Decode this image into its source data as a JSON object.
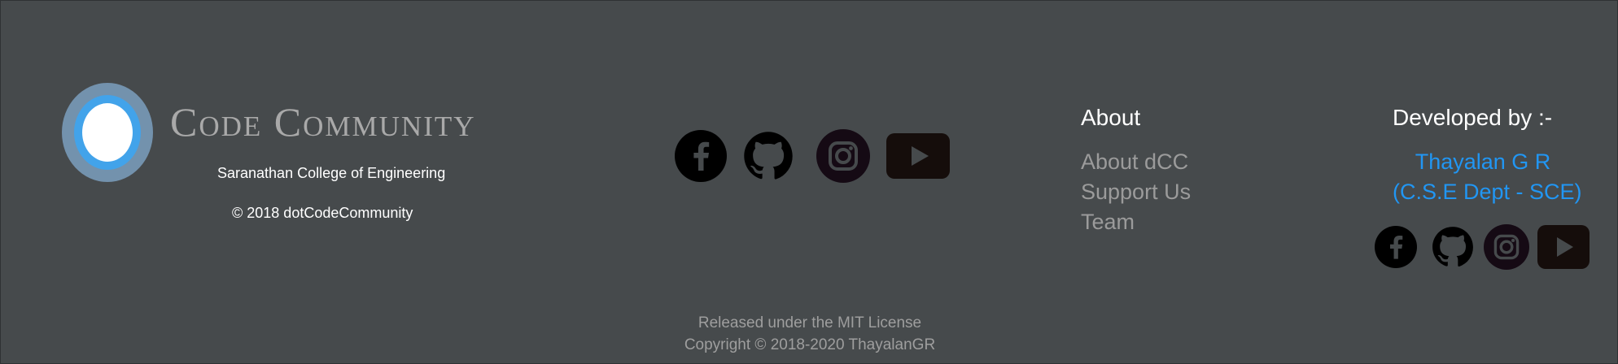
{
  "brand": {
    "name": "Code Community",
    "college": "Saranathan College of Engineering",
    "copyright": "© 2018 dotCodeCommunity"
  },
  "social_main": [
    {
      "icon": "facebook-icon"
    },
    {
      "icon": "github-icon"
    },
    {
      "icon": "instagram-icon"
    },
    {
      "icon": "youtube-icon"
    }
  ],
  "about": {
    "title": "About",
    "links": [
      "About dCC",
      "Support Us",
      "Team"
    ]
  },
  "developer": {
    "title": "Developed by :-",
    "name": "Thayalan G R",
    "dept": "(C.S.E Dept - SCE)"
  },
  "license": {
    "line1": "Released under the MIT License",
    "line2": "Copyright © 2018-2020 ThayalanGR"
  },
  "colors": {
    "background": "#464a4c",
    "link_accent": "#2196f3",
    "muted_text": "#9b9b9b",
    "logo_outer": "#7392ad",
    "logo_ring": "#42a3ea"
  }
}
